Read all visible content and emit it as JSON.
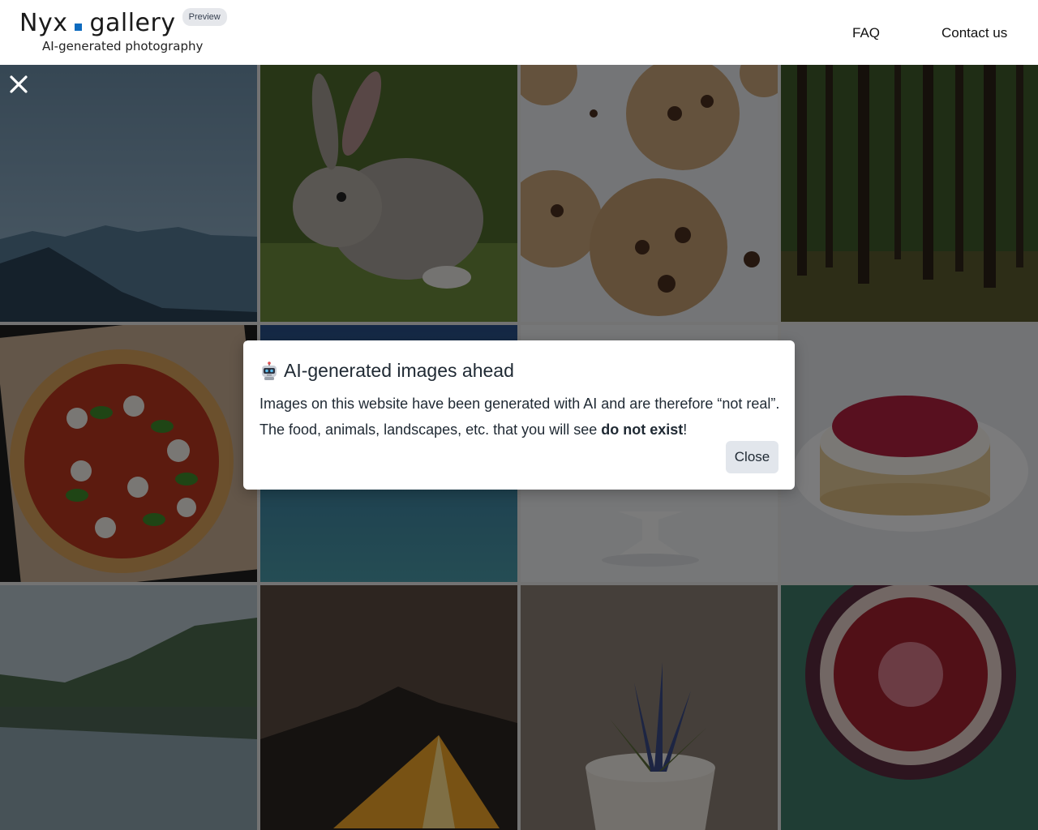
{
  "header": {
    "logo_left": "Nyx",
    "logo_right": "gallery",
    "badge": "Preview",
    "tagline": "AI-generated photography",
    "nav": [
      "FAQ",
      "Contact us"
    ]
  },
  "gallery": {
    "tiles": [
      "mountains",
      "rabbit",
      "cookies",
      "forest",
      "pizza",
      "ocean",
      "cake-stand",
      "raspberry-cake",
      "lake",
      "tent",
      "plant",
      "fig"
    ]
  },
  "modal": {
    "title": "AI-generated images ahead",
    "line1": "Images on this website have been generated with AI and are therefore “not real”.",
    "line2_prefix": "The food, animals, landscapes, etc. that you will see ",
    "line2_bold": "do not exist",
    "line2_suffix": "!",
    "close_label": "Close"
  },
  "colors": {
    "accent": "#0e6bbf",
    "overlay": "rgba(0,0,0,0.5)"
  }
}
